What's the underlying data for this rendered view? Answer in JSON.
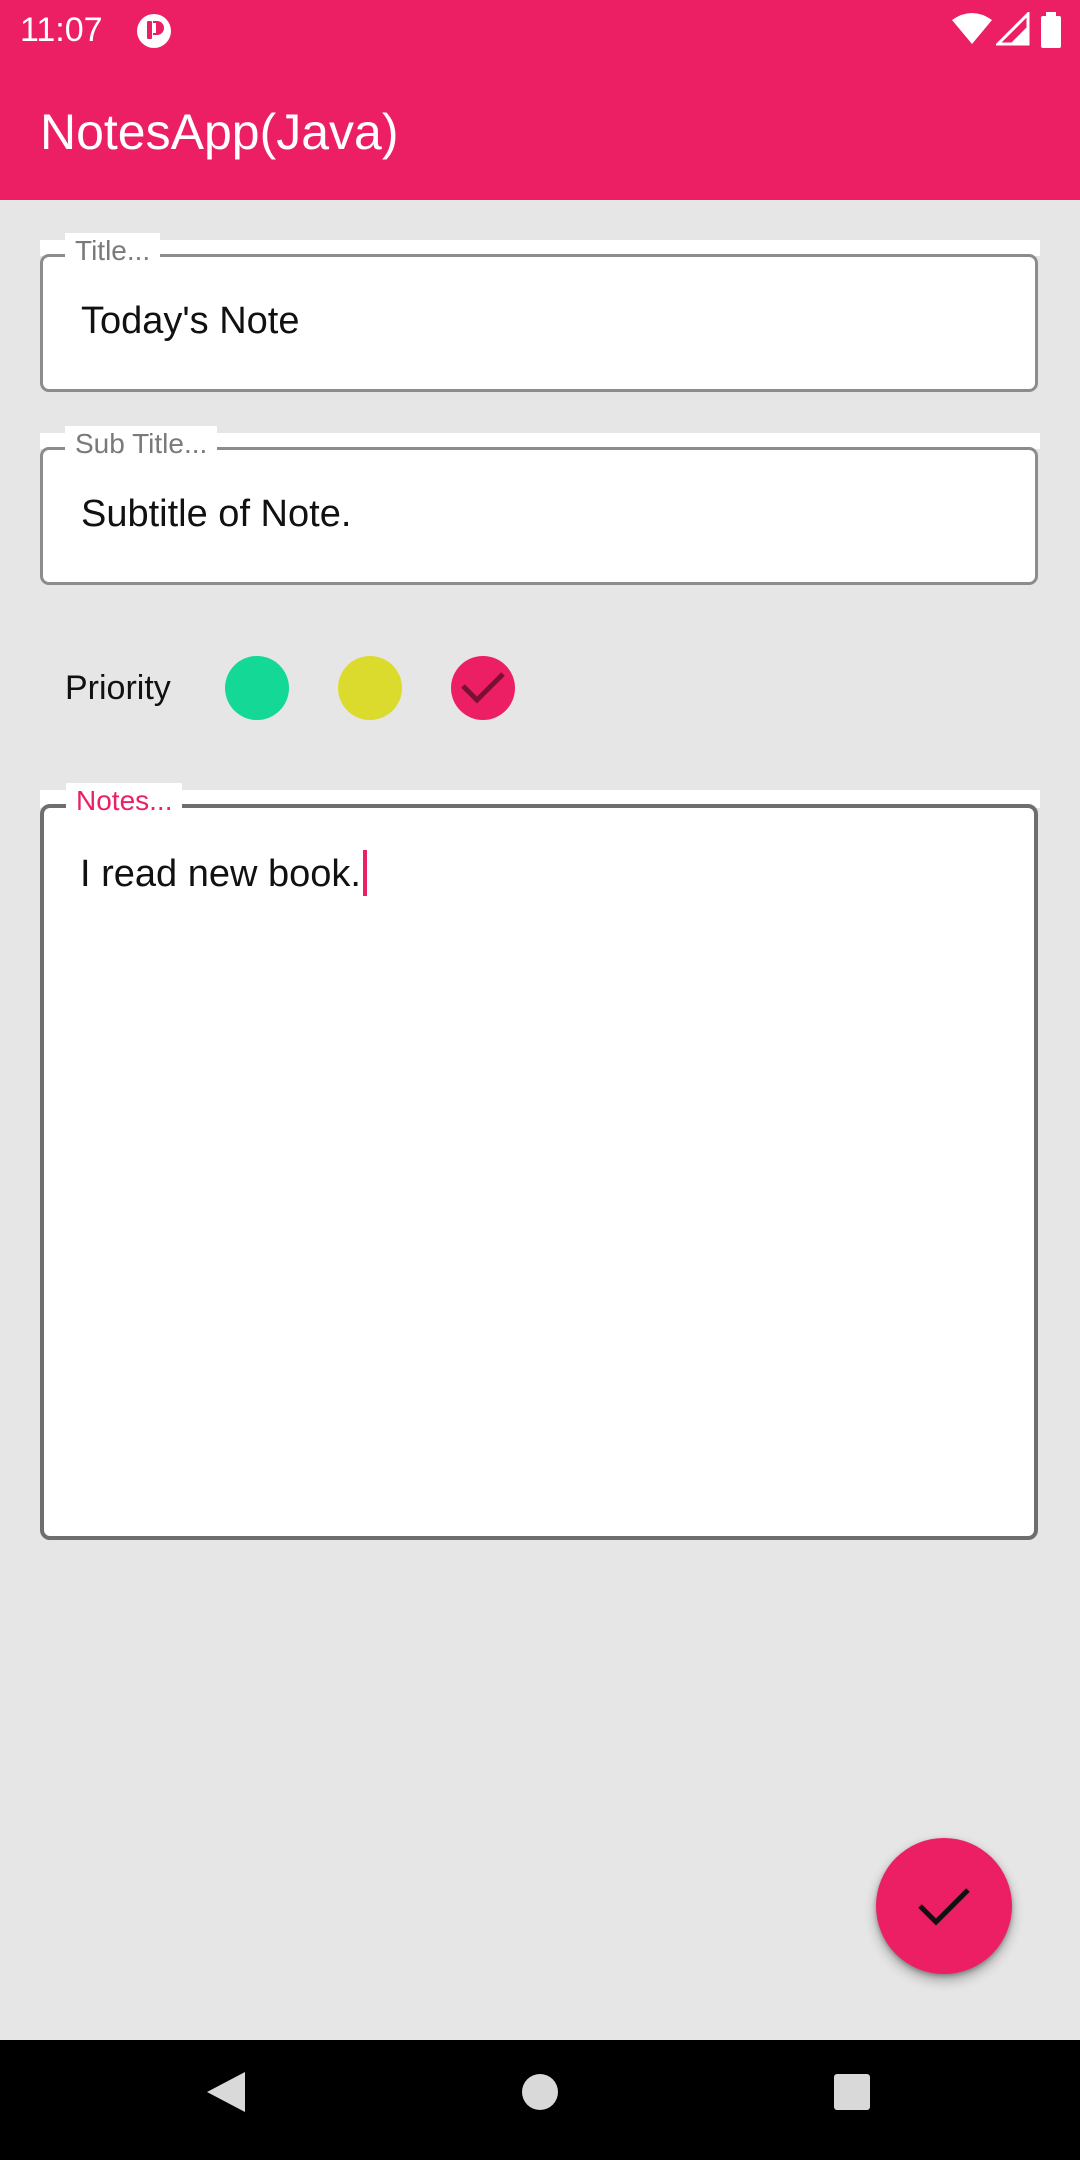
{
  "status_bar": {
    "time": "11:07",
    "icons": [
      "notification-icon",
      "wifi-icon",
      "signal-icon",
      "battery-icon"
    ]
  },
  "app_bar": {
    "title": "NotesApp(Java)",
    "color": "#ec1f65"
  },
  "form": {
    "title_field": {
      "label": "Title...",
      "value": "Today's Note"
    },
    "subtitle_field": {
      "label": "Sub Title...",
      "value": "Subtitle of Note."
    },
    "priority": {
      "label": "Priority",
      "options": [
        {
          "name": "low",
          "color": "#13d896",
          "selected": false
        },
        {
          "name": "medium",
          "color": "#dbdb2e",
          "selected": false
        },
        {
          "name": "high",
          "color": "#ec1f65",
          "selected": true
        }
      ]
    },
    "notes_field": {
      "label": "Notes...",
      "value": "I read new book."
    }
  },
  "fab": {
    "icon": "check-icon"
  },
  "nav_bar": {
    "buttons": [
      "back-icon",
      "home-icon",
      "recents-icon"
    ]
  }
}
